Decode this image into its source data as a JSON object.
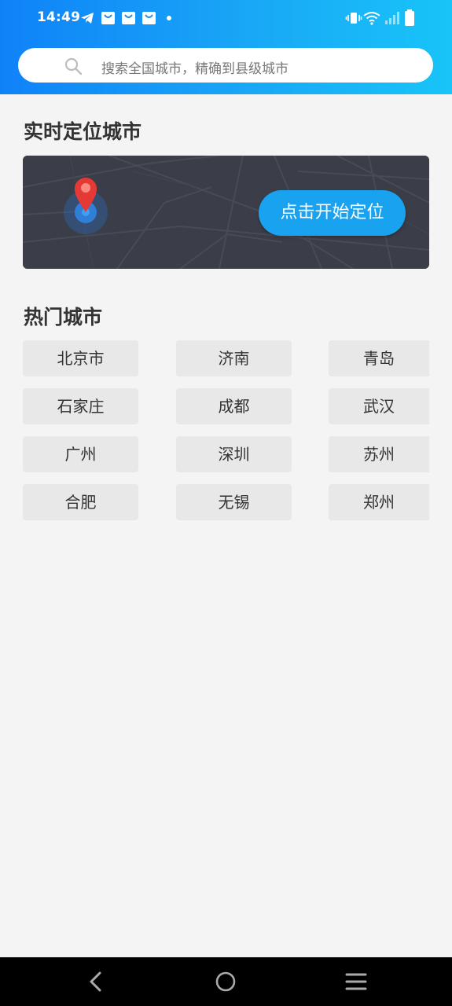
{
  "status_bar": {
    "time": "14:49"
  },
  "search": {
    "placeholder": "搜索全国城市，精确到县级城市"
  },
  "locate_section": {
    "title": "实时定位城市",
    "button_label": "点击开始定位"
  },
  "hot_section": {
    "title": "热门城市",
    "cities": [
      "北京市",
      "济南",
      "青岛",
      "石家庄",
      "成都",
      "武汉",
      "广州",
      "深圳",
      "苏州",
      "合肥",
      "无锡",
      "郑州"
    ]
  },
  "colors": {
    "header_gradient_start": "#0f82f8",
    "header_gradient_end": "#18c4f8",
    "accent_button": "#18a2f0",
    "card_background": "#3b3e48",
    "city_button_background": "#e8e8e8",
    "page_background": "#f4f4f4"
  },
  "icons": {
    "status_left": [
      "telegram-icon",
      "shopping-bag-icon",
      "shopping-bag-icon",
      "shopping-bag-icon",
      "dot-icon"
    ],
    "status_right": [
      "vibrate-icon",
      "wifi-icon",
      "signal-icon",
      "battery-icon"
    ],
    "search": "search-icon",
    "location": "location-pin-icon",
    "nav": [
      "back-icon",
      "home-icon",
      "menu-icon"
    ]
  }
}
